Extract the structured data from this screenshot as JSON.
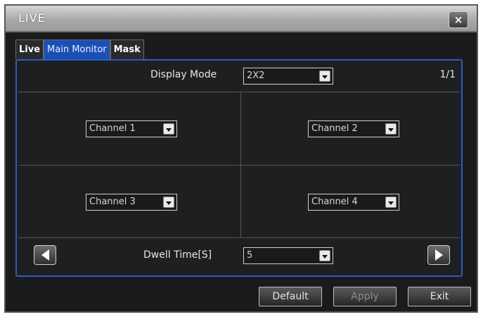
{
  "window": {
    "title": "LIVE",
    "close_label": "×"
  },
  "tabs": [
    {
      "label": "Live"
    },
    {
      "label": "Main Monitor"
    },
    {
      "label": "Mask"
    }
  ],
  "display_mode": {
    "label": "Display Mode",
    "value": "2X2"
  },
  "page_count": "1/1",
  "channels": [
    {
      "value": "Channel 1"
    },
    {
      "value": "Channel 2"
    },
    {
      "value": "Channel 3"
    },
    {
      "value": "Channel 4"
    }
  ],
  "dwell": {
    "label": "Dwell Time[S]",
    "value": "5"
  },
  "buttons": {
    "default": "Default",
    "apply": "Apply",
    "exit": "Exit"
  },
  "icons": {
    "prev": "left-triangle-icon",
    "next": "right-triangle-icon"
  },
  "colors": {
    "accent": "#1c4fb4",
    "panel_border": "#2a5cbe",
    "background": "#1b1b1d"
  }
}
